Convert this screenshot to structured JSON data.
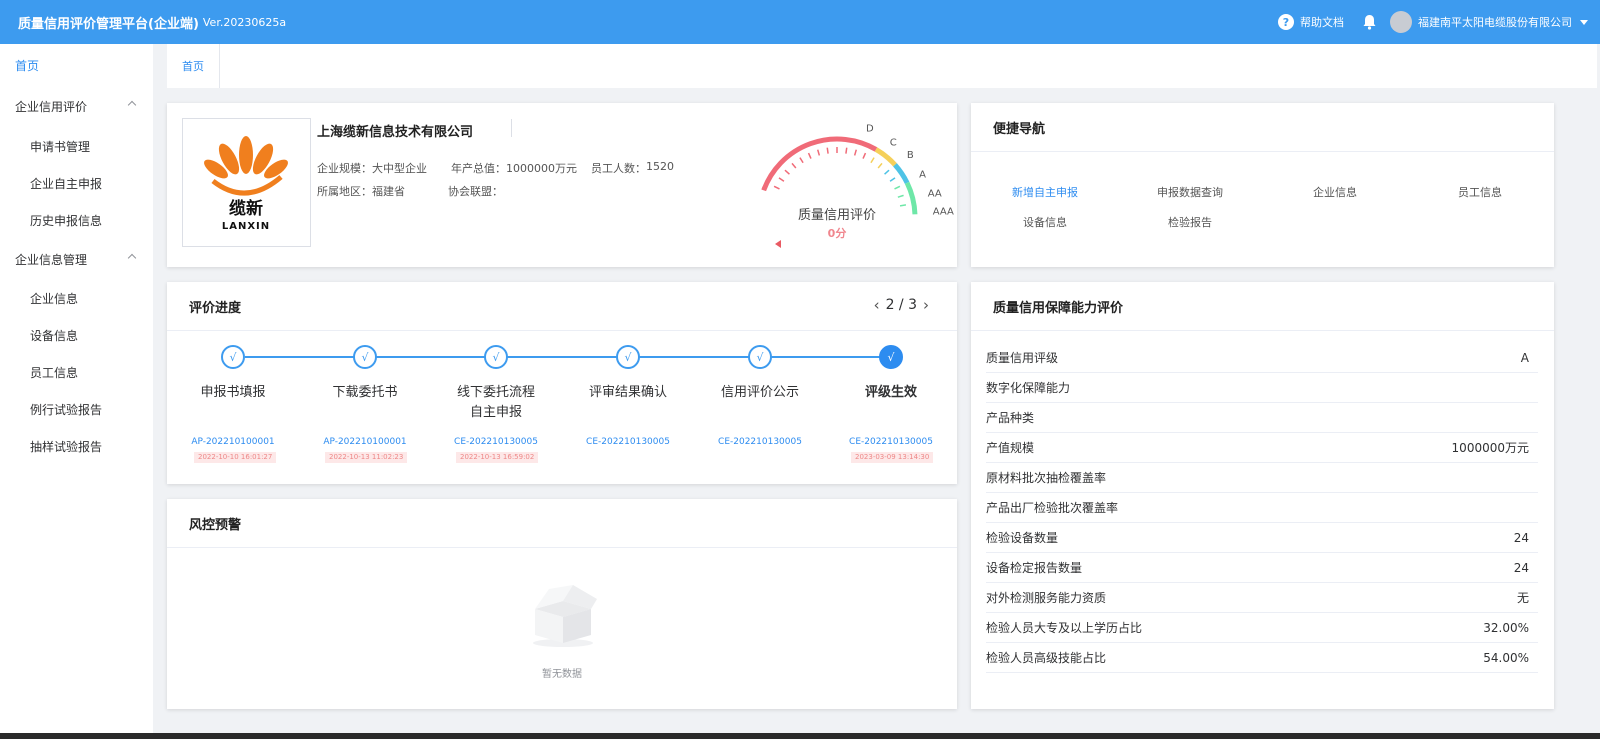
{
  "header": {
    "title": "质量信用评价管理平台(企业端)",
    "version": "Ver.20230625a",
    "help_icon": "question-circle-icon",
    "help_label": "帮助文档",
    "bell_icon": "bell-icon",
    "company": "福建南平太阳电缆股份有限公司",
    "accent": "#3d9bef"
  },
  "sidebar": {
    "home": "首页",
    "group1": "企业信用评价",
    "group1_items": [
      "申请书管理",
      "企业自主申报",
      "历史申报信息"
    ],
    "group2": "企业信息管理",
    "group2_items": [
      "企业信息",
      "设备信息",
      "员工信息",
      "例行试验报告",
      "抽样试验报告"
    ]
  },
  "tabs": [
    "首页"
  ],
  "company": {
    "logo_text_cn": "缆新",
    "logo_text_en": "LANXIN",
    "name": "上海缆新信息技术有限公司",
    "scale_label": "企业规模：",
    "scale": "大中型企业",
    "output_label": "年产总值：",
    "output": "1000000万元",
    "staff_label": "员工人数：",
    "staff": "1520",
    "region_label": "所属地区：",
    "region": "福建省",
    "alliance_label": "协会联盟：",
    "alliance": ""
  },
  "gauge": {
    "title": "质量信用评价",
    "score": "0分",
    "grades": [
      "D",
      "C",
      "B",
      "A",
      "AA",
      "AAA"
    ]
  },
  "quick_nav": {
    "title": "便捷导航",
    "links": [
      "新增自主申报",
      "申报数据查询",
      "企业信息",
      "员工信息",
      "设备信息",
      "检验报告"
    ]
  },
  "progress": {
    "title": "评价进度",
    "page": "2 / 3",
    "steps": [
      {
        "label": "申报书填报",
        "label2": "",
        "code": "AP-202210100001",
        "time": "2022-10-10 16:01:27"
      },
      {
        "label": "下载委托书",
        "label2": "",
        "code": "AP-202210100001",
        "time": "2022-10-13 11:02:23"
      },
      {
        "label": "线下委托流程",
        "label2": "自主申报",
        "code": "CE-202210130005",
        "time": "2022-10-13 16:59:02"
      },
      {
        "label": "评审结果确认",
        "label2": "",
        "code": "CE-202210130005",
        "time": ""
      },
      {
        "label": "信用评价公示",
        "label2": "",
        "code": "CE-202210130005",
        "time": ""
      },
      {
        "label": "评级生效",
        "label2": "",
        "code": "CE-202210130005",
        "time": "2023-03-09 13:14:30"
      }
    ]
  },
  "risk": {
    "title": "风控预警",
    "empty_text": "暂无数据"
  },
  "ability": {
    "title": "质量信用保障能力评价",
    "rows": [
      {
        "label": "质量信用评级",
        "value": "A"
      },
      {
        "label": "数字化保障能力",
        "value": ""
      },
      {
        "label": "产品种类",
        "value": ""
      },
      {
        "label": "产值规模",
        "value": "1000000万元"
      },
      {
        "label": "原材料批次抽检覆盖率",
        "value": ""
      },
      {
        "label": "产品出厂检验批次覆盖率",
        "value": ""
      },
      {
        "label": "检验设备数量",
        "value": "24"
      },
      {
        "label": "设备检定报告数量",
        "value": "24"
      },
      {
        "label": "对外检测服务能力资质",
        "value": "无"
      },
      {
        "label": "检验人员大专及以上学历占比",
        "value": "32.00%"
      },
      {
        "label": "检验人员高级技能占比",
        "value": "54.00%"
      }
    ]
  }
}
